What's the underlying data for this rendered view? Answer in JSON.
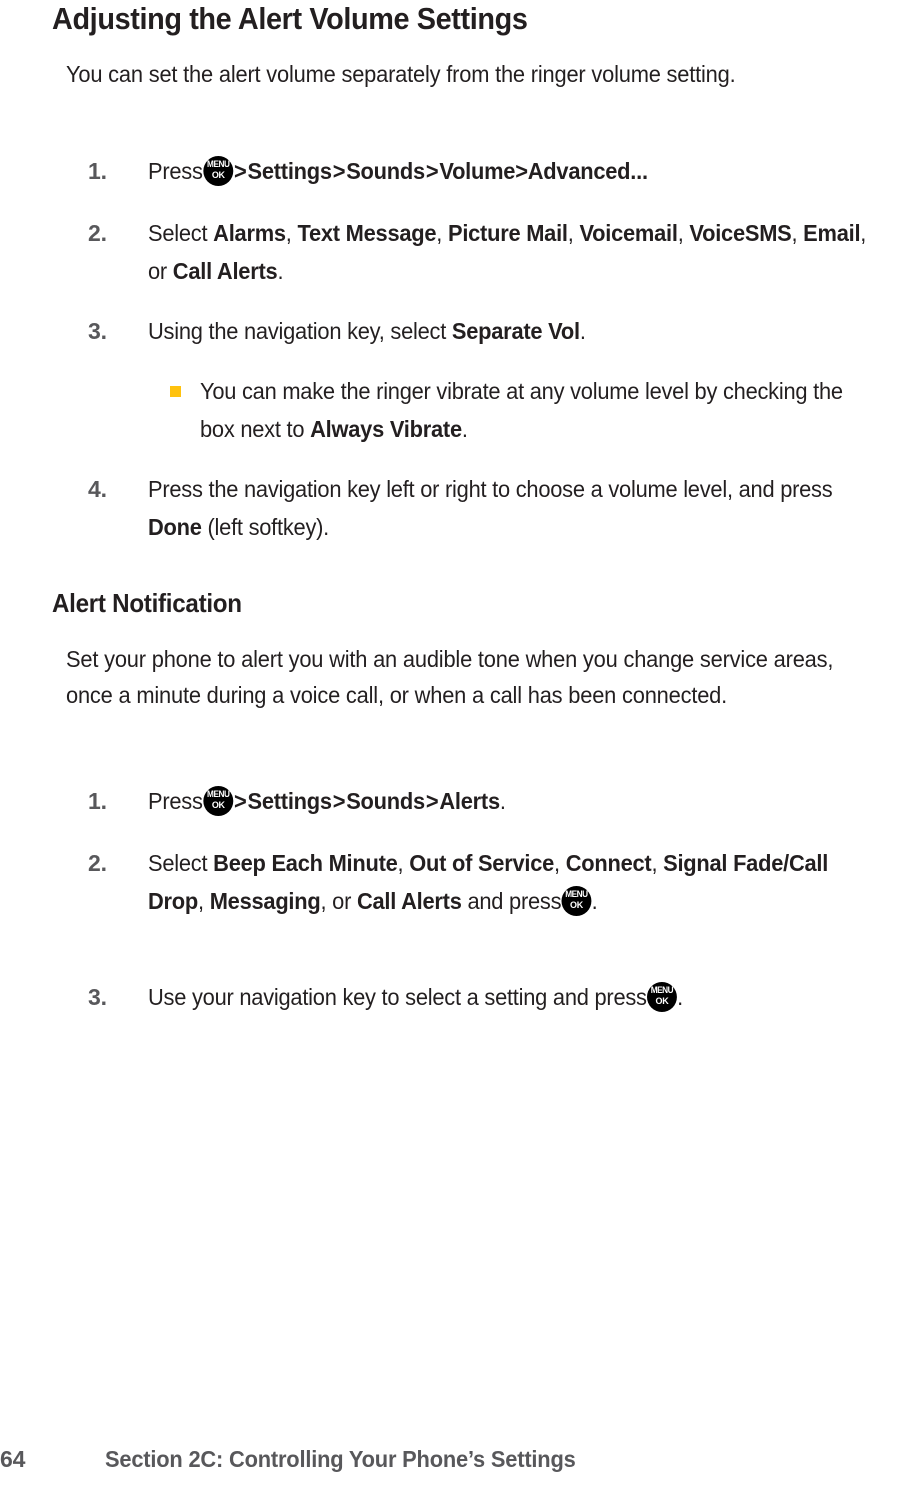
{
  "document": {
    "page_number": "64",
    "footer_title": "Section 2C: Controlling Your Phone’s Settings",
    "bullet_color": "#ffc20e",
    "number_color": "#58585b",
    "text_color": "#231f20"
  },
  "section1": {
    "heading": "Adjusting the Alert Volume Settings",
    "intro": "You can set the alert volume separately from the ringer volume setting.",
    "steps": [
      {
        "number": "1.",
        "lead": "Press",
        "menu_key": {
          "top": "MENU",
          "bottom": "OK"
        },
        "sep1": ">",
        "path1": "Settings",
        "sep2": ">",
        "path2": "Sounds",
        "sep3": ">",
        "path3": "Volume",
        "sep4": ">",
        "path4": "Advanced..."
      },
      {
        "number": "2.",
        "lead": "Select",
        "opt1": "Alarms",
        "c1": ",",
        "opt2": "Text Message",
        "c2": ",",
        "opt3": "Picture Mail",
        "c3": ",",
        "opt4": "Voicemail",
        "c4": ",",
        "opt5": "VoiceSMS",
        "c5": ",",
        "opt6": "Email",
        "conj": ", or",
        "opt7": "Call Alerts",
        "end": "."
      },
      {
        "number": "3.",
        "lead": "Using the navigation key, select",
        "target": "Separate Vol",
        "end": "."
      },
      {
        "number": "4.",
        "lead": "Press the navigation key left or right to choose a volume level, and press",
        "target": "Done",
        "end": "(left softkey)."
      }
    ],
    "sub_bullet": {
      "lead": "You can make the ringer vibrate at any volume level by checking the box next to",
      "target": "Always Vibrate",
      "end": "."
    }
  },
  "section2": {
    "heading": "Alert Notification",
    "intro": "Set your phone to alert you with an audible tone when you change service areas, once a minute during a voice call, or when a call has been connected.",
    "steps": [
      {
        "number": "1.",
        "lead": "Press",
        "menu_key": {
          "top": "MENU",
          "bottom": "OK"
        },
        "sep1": ">",
        "path1": "Settings",
        "sep2": ">",
        "path2": "Sounds",
        "sep3": ">",
        "path3": "Alerts",
        "end": "."
      },
      {
        "number": "2.",
        "lead": "Select",
        "opt1": "Beep Each Minute",
        "c1": ",",
        "opt2": "Out of Service",
        "c2": ",",
        "opt3": "Connect",
        "c3": ",",
        "opt4": "Signal Fade/Call Drop",
        "c4": ",",
        "opt5": "Messaging",
        "conj": ", or",
        "opt6": "Call Alerts",
        "tail": "and press",
        "menu_key": {
          "top": "MENU",
          "bottom": "OK"
        },
        "end": "."
      },
      {
        "number": "3.",
        "lead": "Use your navigation key to select a setting and press",
        "menu_key": {
          "top": "MENU",
          "bottom": "OK"
        },
        "end": "."
      }
    ]
  }
}
